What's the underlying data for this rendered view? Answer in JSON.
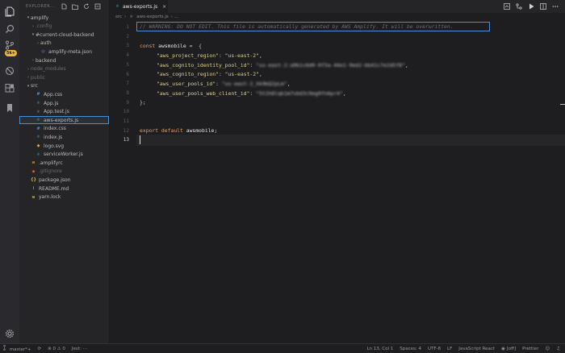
{
  "activity": {
    "icons": [
      "files-icon",
      "search-icon",
      "source-control-icon",
      "debug-icon",
      "extensions-icon",
      "bookmark-icon",
      "gear-icon"
    ],
    "scm_badge": "5k+"
  },
  "sidebar": {
    "title": "EXPLORER...",
    "tree": [
      {
        "label": "amplify",
        "chev": "▾",
        "indent": 8,
        "type": "folder",
        "dim": false
      },
      {
        "label": ".config",
        "chev": "›",
        "indent": 14,
        "type": "folder",
        "dim": true
      },
      {
        "label": "#current-cloud-backend",
        "chev": "▾",
        "indent": 14,
        "type": "folder",
        "dim": false
      },
      {
        "label": "auth",
        "chev": "›",
        "indent": 20,
        "type": "folder",
        "dim": false
      },
      {
        "label": "amplify-meta.json",
        "chev": "",
        "indent": 20,
        "type": "json",
        "dim": false
      },
      {
        "label": "backend",
        "chev": "›",
        "indent": 14,
        "type": "folder",
        "dim": false
      },
      {
        "label": "node_modules",
        "chev": "›",
        "indent": 8,
        "type": "folder",
        "dim": true
      },
      {
        "label": "public",
        "chev": "›",
        "indent": 8,
        "type": "folder",
        "dim": true
      },
      {
        "label": "src",
        "chev": "▾",
        "indent": 8,
        "type": "folder",
        "dim": false
      },
      {
        "label": "App.css",
        "chev": "",
        "indent": 14,
        "type": "css",
        "dim": false
      },
      {
        "label": "App.js",
        "chev": "",
        "indent": 14,
        "type": "js",
        "dim": false
      },
      {
        "label": "App.test.js",
        "chev": "",
        "indent": 14,
        "type": "js",
        "dim": false
      },
      {
        "label": "aws-exports.js",
        "chev": "",
        "indent": 14,
        "type": "js",
        "dim": false,
        "selected": true
      },
      {
        "label": "index.css",
        "chev": "",
        "indent": 14,
        "type": "css",
        "dim": false
      },
      {
        "label": "index.js",
        "chev": "",
        "indent": 14,
        "type": "js",
        "dim": false
      },
      {
        "label": "logo.svg",
        "chev": "",
        "indent": 14,
        "type": "svg",
        "dim": false
      },
      {
        "label": "serviceWorker.js",
        "chev": "",
        "indent": 14,
        "type": "js",
        "dim": false
      },
      {
        "label": ".amplifyrc",
        "chev": "",
        "indent": 8,
        "type": "rc",
        "dim": false
      },
      {
        "label": ".gitignore",
        "chev": "",
        "indent": 8,
        "type": "git",
        "dim": true
      },
      {
        "label": "package.json",
        "chev": "",
        "indent": 8,
        "type": "json",
        "dim": false
      },
      {
        "label": "README.md",
        "chev": "",
        "indent": 8,
        "type": "md",
        "dim": false
      },
      {
        "label": "yarn.lock",
        "chev": "",
        "indent": 8,
        "type": "lock",
        "dim": false
      }
    ]
  },
  "tab": {
    "label": "aws-exports.js",
    "close": "×"
  },
  "breadcrumb": {
    "folder": "src",
    "sep": "›",
    "file": "aws-exports.js",
    "more": "› ..."
  },
  "editor": {
    "line_numbers": [
      "1",
      "2",
      "3",
      "4",
      "5",
      "6",
      "7",
      "8",
      "9",
      "10",
      "11",
      "12",
      "13"
    ],
    "active_line": 13,
    "comment": "// WARNING: DO NOT EDIT. This file is automatically generated by AWS Amplify. It will be overwritten.",
    "const_kw": "const",
    "var_name": "awsmobile",
    "assign": " =  {",
    "props": [
      {
        "key": "\"aws_project_region\"",
        "value": "\"us-east-2\"",
        "blur": false
      },
      {
        "key": "\"aws_cognito_identity_pool_id\"",
        "value": "\"us-east-2:a9b1c6d0-0f3a-44e1-9ed2-bb41c7e2d5f8\"",
        "blur": true
      },
      {
        "key": "\"aws_cognito_region\"",
        "value": "\"us-east-2\"",
        "blur": false
      },
      {
        "key": "\"aws_user_pools_id\"",
        "value": "\"us-east-2_Xk9bQ2pLm\"",
        "blur": true
      },
      {
        "key": "\"aws_user_pools_web_client_id\"",
        "value": "\"5t2h8lqk1m7vbd3c9eg0fn6pr4\"",
        "blur": true
      }
    ],
    "close": "};",
    "export_kw": "export default",
    "export_name": "awsmobile;"
  },
  "status": {
    "branch": "master*+",
    "errors": "0",
    "warnings": "0",
    "jest": "Jest: ",
    "position": "Ln 13, Col 1",
    "spaces": "Spaces: 4",
    "encoding": "UTF-8",
    "eol": "LF",
    "language": "JavaScript React",
    "live": "[off]",
    "formatter": "Prettier"
  },
  "colors": {
    "accent": "#4a8fd4",
    "badge": "#f0b43c",
    "keyword": "#e8a05a",
    "string": "#dcd08f"
  }
}
